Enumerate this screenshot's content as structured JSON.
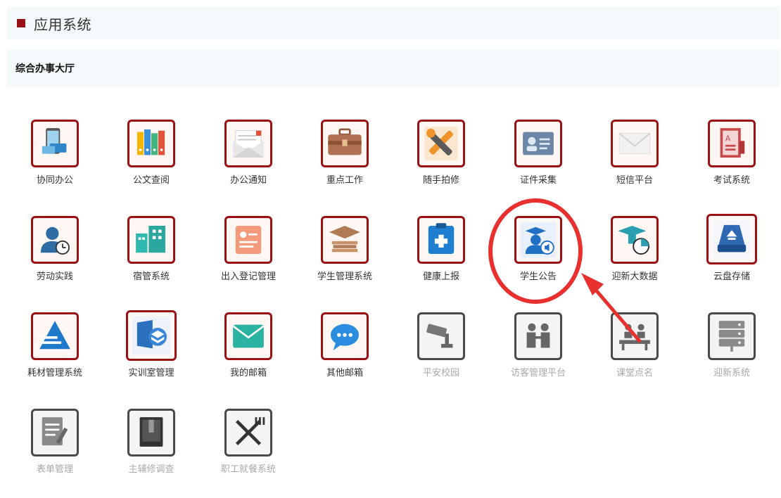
{
  "header": {
    "title": "应用系统"
  },
  "subbar": {
    "title": "综合办事大厅"
  },
  "colors": {
    "brand": "#9b1015",
    "header_bg": "#f4f9fc",
    "annotation": "#e8302e",
    "disabled_text": "#aaaaaa"
  },
  "apps": [
    {
      "label": "协同办公",
      "icon": "phone-collab-icon",
      "enabled": true
    },
    {
      "label": "公文查阅",
      "icon": "binders-icon",
      "enabled": true
    },
    {
      "label": "办公通知",
      "icon": "envelope-letter-icon",
      "enabled": true
    },
    {
      "label": "重点工作",
      "icon": "briefcase-icon",
      "enabled": true
    },
    {
      "label": "随手拍修",
      "icon": "tools-icon",
      "enabled": true
    },
    {
      "label": "证件采集",
      "icon": "id-card-icon",
      "enabled": true
    },
    {
      "label": "短信平台",
      "icon": "mail-icon",
      "enabled": true
    },
    {
      "label": "考试系统",
      "icon": "exam-book-icon",
      "enabled": true
    },
    {
      "label": "劳动实践",
      "icon": "user-clock-icon",
      "enabled": true
    },
    {
      "label": "宿管系统",
      "icon": "buildings-icon",
      "enabled": true
    },
    {
      "label": "出入登记管理",
      "icon": "register-card-icon",
      "enabled": true
    },
    {
      "label": "学生管理系统",
      "icon": "graduation-books-icon",
      "enabled": true
    },
    {
      "label": "健康上报",
      "icon": "medical-kit-icon",
      "enabled": true
    },
    {
      "label": "学生公告",
      "icon": "student-announce-icon",
      "enabled": true
    },
    {
      "label": "迎新大数据",
      "icon": "grad-cap-chart-icon",
      "enabled": true
    },
    {
      "label": "云盘存储",
      "icon": "cloud-disk-icon",
      "enabled": true
    },
    {
      "label": "耗材管理系统",
      "icon": "pyramid-stack-icon",
      "enabled": true
    },
    {
      "label": "实训室管理",
      "icon": "lab-layers-icon",
      "enabled": true
    },
    {
      "label": "我的邮箱",
      "icon": "envelope-open-icon",
      "enabled": true
    },
    {
      "label": "其他邮箱",
      "icon": "chat-bubble-icon",
      "enabled": true
    },
    {
      "label": "平安校园",
      "icon": "cctv-camera-icon",
      "enabled": false
    },
    {
      "label": "访客管理平台",
      "icon": "visitors-icon",
      "enabled": false
    },
    {
      "label": "课堂点名",
      "icon": "classroom-icon",
      "enabled": false
    },
    {
      "label": "迎新系统",
      "icon": "server-icon",
      "enabled": false
    },
    {
      "label": "表单管理",
      "icon": "form-edit-icon",
      "enabled": false
    },
    {
      "label": "主辅修调查",
      "icon": "survey-book-icon",
      "enabled": false
    },
    {
      "label": "职工就餐系统",
      "icon": "fork-knife-icon",
      "enabled": false
    }
  ]
}
